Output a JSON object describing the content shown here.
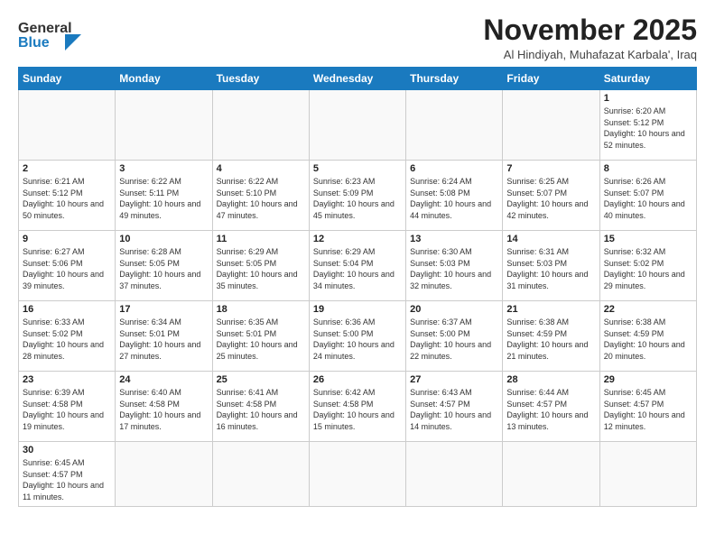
{
  "header": {
    "logo_general": "General",
    "logo_blue": "Blue",
    "month": "November 2025",
    "location": "Al Hindiyah, Muhafazat Karbala', Iraq"
  },
  "weekdays": [
    "Sunday",
    "Monday",
    "Tuesday",
    "Wednesday",
    "Thursday",
    "Friday",
    "Saturday"
  ],
  "weeks": [
    [
      {
        "day": "",
        "info": ""
      },
      {
        "day": "",
        "info": ""
      },
      {
        "day": "",
        "info": ""
      },
      {
        "day": "",
        "info": ""
      },
      {
        "day": "",
        "info": ""
      },
      {
        "day": "",
        "info": ""
      },
      {
        "day": "1",
        "info": "Sunrise: 6:20 AM\nSunset: 5:12 PM\nDaylight: 10 hours\nand 52 minutes."
      }
    ],
    [
      {
        "day": "2",
        "info": "Sunrise: 6:21 AM\nSunset: 5:12 PM\nDaylight: 10 hours\nand 50 minutes."
      },
      {
        "day": "3",
        "info": "Sunrise: 6:22 AM\nSunset: 5:11 PM\nDaylight: 10 hours\nand 49 minutes."
      },
      {
        "day": "4",
        "info": "Sunrise: 6:22 AM\nSunset: 5:10 PM\nDaylight: 10 hours\nand 47 minutes."
      },
      {
        "day": "5",
        "info": "Sunrise: 6:23 AM\nSunset: 5:09 PM\nDaylight: 10 hours\nand 45 minutes."
      },
      {
        "day": "6",
        "info": "Sunrise: 6:24 AM\nSunset: 5:08 PM\nDaylight: 10 hours\nand 44 minutes."
      },
      {
        "day": "7",
        "info": "Sunrise: 6:25 AM\nSunset: 5:07 PM\nDaylight: 10 hours\nand 42 minutes."
      },
      {
        "day": "8",
        "info": "Sunrise: 6:26 AM\nSunset: 5:07 PM\nDaylight: 10 hours\nand 40 minutes."
      }
    ],
    [
      {
        "day": "9",
        "info": "Sunrise: 6:27 AM\nSunset: 5:06 PM\nDaylight: 10 hours\nand 39 minutes."
      },
      {
        "day": "10",
        "info": "Sunrise: 6:28 AM\nSunset: 5:05 PM\nDaylight: 10 hours\nand 37 minutes."
      },
      {
        "day": "11",
        "info": "Sunrise: 6:29 AM\nSunset: 5:05 PM\nDaylight: 10 hours\nand 35 minutes."
      },
      {
        "day": "12",
        "info": "Sunrise: 6:29 AM\nSunset: 5:04 PM\nDaylight: 10 hours\nand 34 minutes."
      },
      {
        "day": "13",
        "info": "Sunrise: 6:30 AM\nSunset: 5:03 PM\nDaylight: 10 hours\nand 32 minutes."
      },
      {
        "day": "14",
        "info": "Sunrise: 6:31 AM\nSunset: 5:03 PM\nDaylight: 10 hours\nand 31 minutes."
      },
      {
        "day": "15",
        "info": "Sunrise: 6:32 AM\nSunset: 5:02 PM\nDaylight: 10 hours\nand 29 minutes."
      }
    ],
    [
      {
        "day": "16",
        "info": "Sunrise: 6:33 AM\nSunset: 5:02 PM\nDaylight: 10 hours\nand 28 minutes."
      },
      {
        "day": "17",
        "info": "Sunrise: 6:34 AM\nSunset: 5:01 PM\nDaylight: 10 hours\nand 27 minutes."
      },
      {
        "day": "18",
        "info": "Sunrise: 6:35 AM\nSunset: 5:01 PM\nDaylight: 10 hours\nand 25 minutes."
      },
      {
        "day": "19",
        "info": "Sunrise: 6:36 AM\nSunset: 5:00 PM\nDaylight: 10 hours\nand 24 minutes."
      },
      {
        "day": "20",
        "info": "Sunrise: 6:37 AM\nSunset: 5:00 PM\nDaylight: 10 hours\nand 22 minutes."
      },
      {
        "day": "21",
        "info": "Sunrise: 6:38 AM\nSunset: 4:59 PM\nDaylight: 10 hours\nand 21 minutes."
      },
      {
        "day": "22",
        "info": "Sunrise: 6:38 AM\nSunset: 4:59 PM\nDaylight: 10 hours\nand 20 minutes."
      }
    ],
    [
      {
        "day": "23",
        "info": "Sunrise: 6:39 AM\nSunset: 4:58 PM\nDaylight: 10 hours\nand 19 minutes."
      },
      {
        "day": "24",
        "info": "Sunrise: 6:40 AM\nSunset: 4:58 PM\nDaylight: 10 hours\nand 17 minutes."
      },
      {
        "day": "25",
        "info": "Sunrise: 6:41 AM\nSunset: 4:58 PM\nDaylight: 10 hours\nand 16 minutes."
      },
      {
        "day": "26",
        "info": "Sunrise: 6:42 AM\nSunset: 4:58 PM\nDaylight: 10 hours\nand 15 minutes."
      },
      {
        "day": "27",
        "info": "Sunrise: 6:43 AM\nSunset: 4:57 PM\nDaylight: 10 hours\nand 14 minutes."
      },
      {
        "day": "28",
        "info": "Sunrise: 6:44 AM\nSunset: 4:57 PM\nDaylight: 10 hours\nand 13 minutes."
      },
      {
        "day": "29",
        "info": "Sunrise: 6:45 AM\nSunset: 4:57 PM\nDaylight: 10 hours\nand 12 minutes."
      }
    ],
    [
      {
        "day": "30",
        "info": "Sunrise: 6:45 AM\nSunset: 4:57 PM\nDaylight: 10 hours\nand 11 minutes."
      },
      {
        "day": "",
        "info": ""
      },
      {
        "day": "",
        "info": ""
      },
      {
        "day": "",
        "info": ""
      },
      {
        "day": "",
        "info": ""
      },
      {
        "day": "",
        "info": ""
      },
      {
        "day": "",
        "info": ""
      }
    ]
  ]
}
